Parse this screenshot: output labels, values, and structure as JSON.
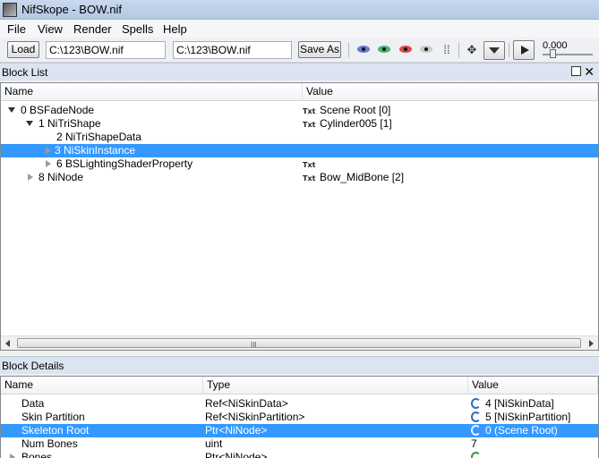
{
  "window": {
    "title": "NifSkope - BOW.nif"
  },
  "menu": [
    "File",
    "View",
    "Render",
    "Spells",
    "Help"
  ],
  "toolbar": {
    "load_label": "Load",
    "load_path": "C:\\123\\BOW.nif",
    "save_path": "C:\\123\\BOW.nif",
    "save_as_label": "Save As",
    "time_value": "0.000"
  },
  "block_list": {
    "title": "Block List",
    "columns": [
      "Name",
      "Value"
    ],
    "rows": [
      {
        "name": "0 BSFadeNode",
        "value": "Scene Root [0]",
        "txt": "Txt"
      },
      {
        "name": "1 NiTriShape",
        "value": "Cylinder005 [1]",
        "txt": "Txt"
      },
      {
        "name": "2 NiTriShapeData",
        "value": "",
        "txt": ""
      },
      {
        "name": "3 NiSkinInstance",
        "value": "",
        "txt": ""
      },
      {
        "name": "6 BSLightingShaderProperty",
        "value": "",
        "txt": "Txt"
      },
      {
        "name": "8 NiNode",
        "value": "Bow_MidBone [2]",
        "txt": "Txt"
      }
    ],
    "scroll_grip": "III"
  },
  "block_details": {
    "title": "Block Details",
    "columns": [
      "Name",
      "Type",
      "Value"
    ],
    "rows": [
      {
        "name": "Data",
        "type": "Ref<NiSkinData>",
        "value": "4 [NiSkinData]"
      },
      {
        "name": "Skin Partition",
        "type": "Ref<NiSkinPartition>",
        "value": "5 [NiSkinPartition]"
      },
      {
        "name": "Skeleton Root",
        "type": "Ptr<NiNode>",
        "value": "0 (Scene Root)"
      },
      {
        "name": "Num Bones",
        "type": "uint",
        "value": "7"
      },
      {
        "name": "Bones",
        "type": "Ptr<NiNode>",
        "value": ""
      }
    ]
  }
}
